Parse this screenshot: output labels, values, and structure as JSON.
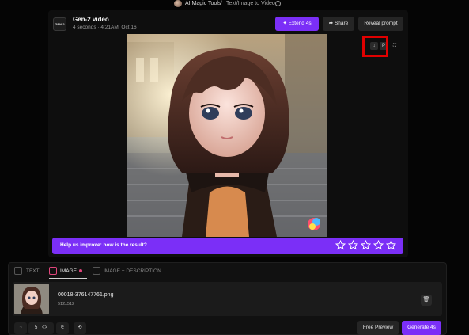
{
  "breadcrumb": {
    "workspace": "AI Magic Tools",
    "separator": "/",
    "page": "Text/Image to Video"
  },
  "video": {
    "model_badge": "GEN-2",
    "title": "Gen-2 video",
    "meta": "4 seconds · 4:21AM, Oct 16"
  },
  "header_buttons": {
    "extend": "Extend 4s",
    "share": "Share",
    "reveal": "Reveal prompt"
  },
  "image_tools": {
    "download": "download-icon",
    "p_label": "P",
    "expand": "expand-icon"
  },
  "feedback": {
    "question": "Help us improve: how is the result?",
    "stars": 5
  },
  "tabs": [
    {
      "label": "TEXT"
    },
    {
      "label": "IMAGE",
      "active": true
    },
    {
      "label": "IMAGE + DESCRIPTION"
    }
  ],
  "file": {
    "name": "00018-376147761.png",
    "size": "512x512"
  },
  "controls": {
    "duration": "5",
    "preview": "Free Preview",
    "generate": "Generate 4s"
  },
  "colors": {
    "accent": "#7b2ff7",
    "highlight": "#e00000",
    "background": "#050505"
  }
}
